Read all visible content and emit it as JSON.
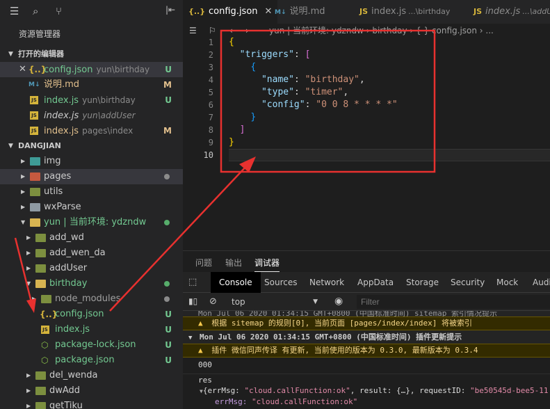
{
  "sidebar": {
    "title": "资源管理器",
    "open_editors": {
      "label": "打开的编辑器",
      "items": [
        {
          "name": "config.json",
          "path": "yun\\birthday",
          "status": "U"
        },
        {
          "name": "说明.md",
          "path": "",
          "status": "M"
        },
        {
          "name": "index.js",
          "path": "yun\\birthday",
          "status": "U"
        },
        {
          "name": "index.js",
          "path": "yun\\addUser",
          "status": ""
        },
        {
          "name": "index.js",
          "path": "pages\\index",
          "status": "M"
        }
      ]
    },
    "project": {
      "label": "DANGJIAN",
      "items": [
        "img",
        "pages",
        "utils",
        "wxParse",
        "yun | 当前环境: ydzndw",
        "add_wd",
        "add_wen_da",
        "addUser",
        "birthday",
        "node_modules",
        "config.json",
        "index.js",
        "package-lock.json",
        "package.json",
        "del_wenda",
        "dwAdd",
        "getTiku"
      ],
      "statuses": {
        "config": "U",
        "index": "U",
        "lock": "U",
        "pkg": "U"
      }
    }
  },
  "editor": {
    "tabs": [
      {
        "name": "config.json",
        "sub": ""
      },
      {
        "name": "说明.md",
        "sub": ""
      },
      {
        "name": "index.js",
        "sub": "...\\birthday"
      },
      {
        "name": "index.js",
        "sub": "...\\addU"
      }
    ],
    "breadcrumb": "yun | 当前环境: ydzndw  ›  birthday  ›  { }  config.json  ›  ...",
    "line_numbers": [
      "1",
      "2",
      "3",
      "4",
      "5",
      "6",
      "7",
      "8",
      "9",
      "10"
    ],
    "code": {
      "key_triggers": "\"triggers\"",
      "key_name": "\"name\"",
      "val_name": "\"birthday\"",
      "key_type": "\"type\"",
      "val_type": "\"timer\"",
      "key_config": "\"config\"",
      "val_config": "\"0 0 8 * * * *\""
    }
  },
  "panel": {
    "tabs": [
      "问题",
      "输出",
      "调试器"
    ],
    "devtools": [
      "Console",
      "Sources",
      "Network",
      "AppData",
      "Storage",
      "Security",
      "Mock",
      "Audi"
    ],
    "context": "top",
    "filter_placeholder": "Filter",
    "lines": {
      "cut": "Mon Jul 06 2020 01:34:15 GMT+0800 (中国标准时间) sitemap 索引情况提示",
      "warn1": "根据 sitemap 的规则[0], 当前页面 [pages/index/index] 将被索引",
      "header2": "Mon Jul 06 2020 01:34:15 GMT+0800 (中国标准时间) 插件更新提示",
      "warn2": "插件 微信同声传译 有更新, 当前使用的版本为 0.3.0, 最新版本为 0.3.4",
      "log1": "000",
      "log2": "res",
      "obj_open": "{errMsg: ",
      "obj_errmsg_val": "\"cloud.callFunction:ok\"",
      "obj_mid": ", result: {…}, requestID: ",
      "obj_reqid": "\"be50545d-bee5-11",
      "prop_key": "errMsg: ",
      "prop_val": "\"cloud.callFunction:ok\""
    }
  },
  "colors": {
    "annotation": "#e8312f",
    "accent": "#0e639c"
  }
}
